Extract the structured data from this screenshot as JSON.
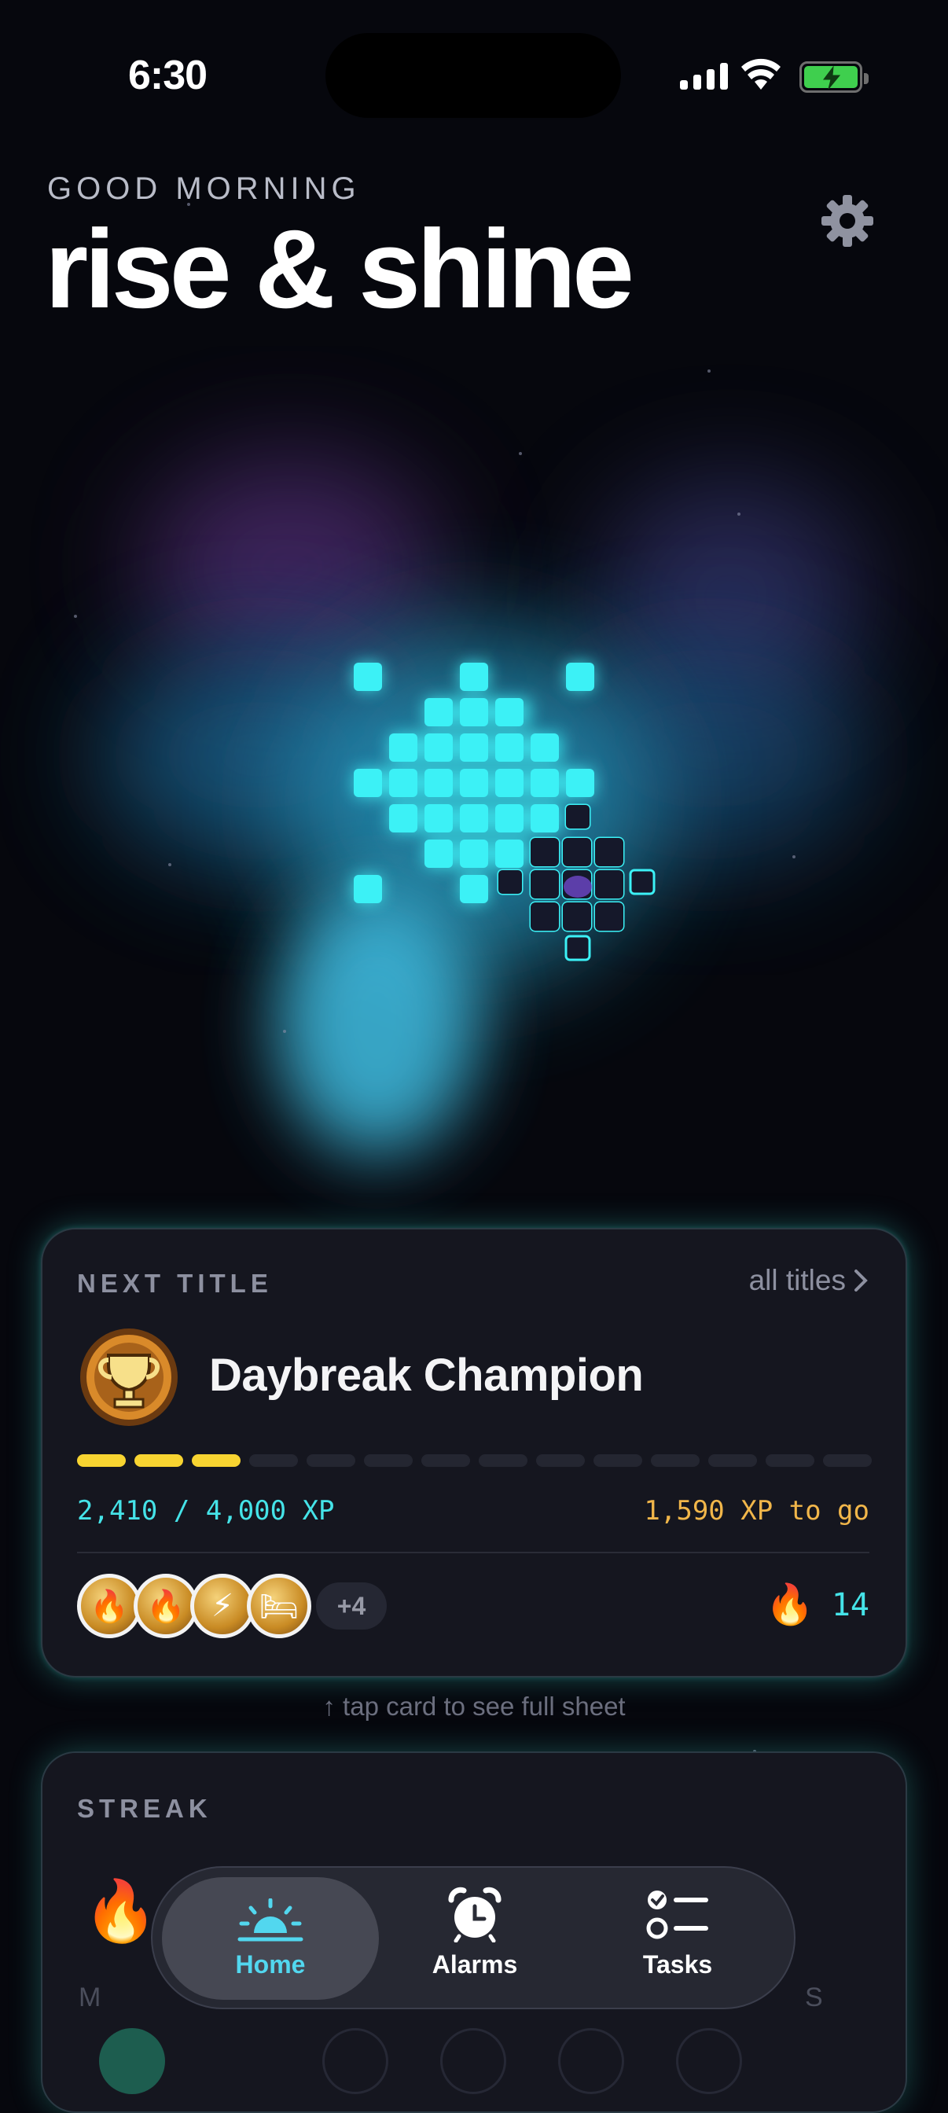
{
  "status_bar": {
    "time": "6:30"
  },
  "header": {
    "greeting": "GOOD MORNING",
    "headline": "rise & shine",
    "settings_icon": "gear-icon"
  },
  "next_title_card": {
    "label": "NEXT TITLE",
    "link_label": "all titles",
    "title_name": "Daybreak Champion",
    "trophy_icon": "trophy-icon",
    "progress_segments_filled": 3,
    "progress_segments_total": 14,
    "xp_progress": "2,410 / 4,000 XP",
    "xp_remaining": "1,590 XP to go",
    "badges": [
      "fire-badge",
      "flame-badge",
      "lightning-badge",
      "bed-badge"
    ],
    "more_badges": "+4",
    "streak_count": "14"
  },
  "hint": "↑ tap card to see full sheet",
  "streak_card": {
    "label": "STREAK",
    "days_visible": [
      "M",
      "S"
    ]
  },
  "tab_bar": {
    "tabs": [
      {
        "label": "Home",
        "icon": "sunrise-icon",
        "active": true
      },
      {
        "label": "Alarms",
        "icon": "alarm-clock-icon",
        "active": false
      },
      {
        "label": "Tasks",
        "icon": "checklist-icon",
        "active": false
      }
    ]
  },
  "colors": {
    "background": "#06070d",
    "accent_cyan": "#45e3e8",
    "xp_gold": "#f1b64a",
    "progress_yellow": "#f8d431",
    "card_bg": "#15161f"
  }
}
